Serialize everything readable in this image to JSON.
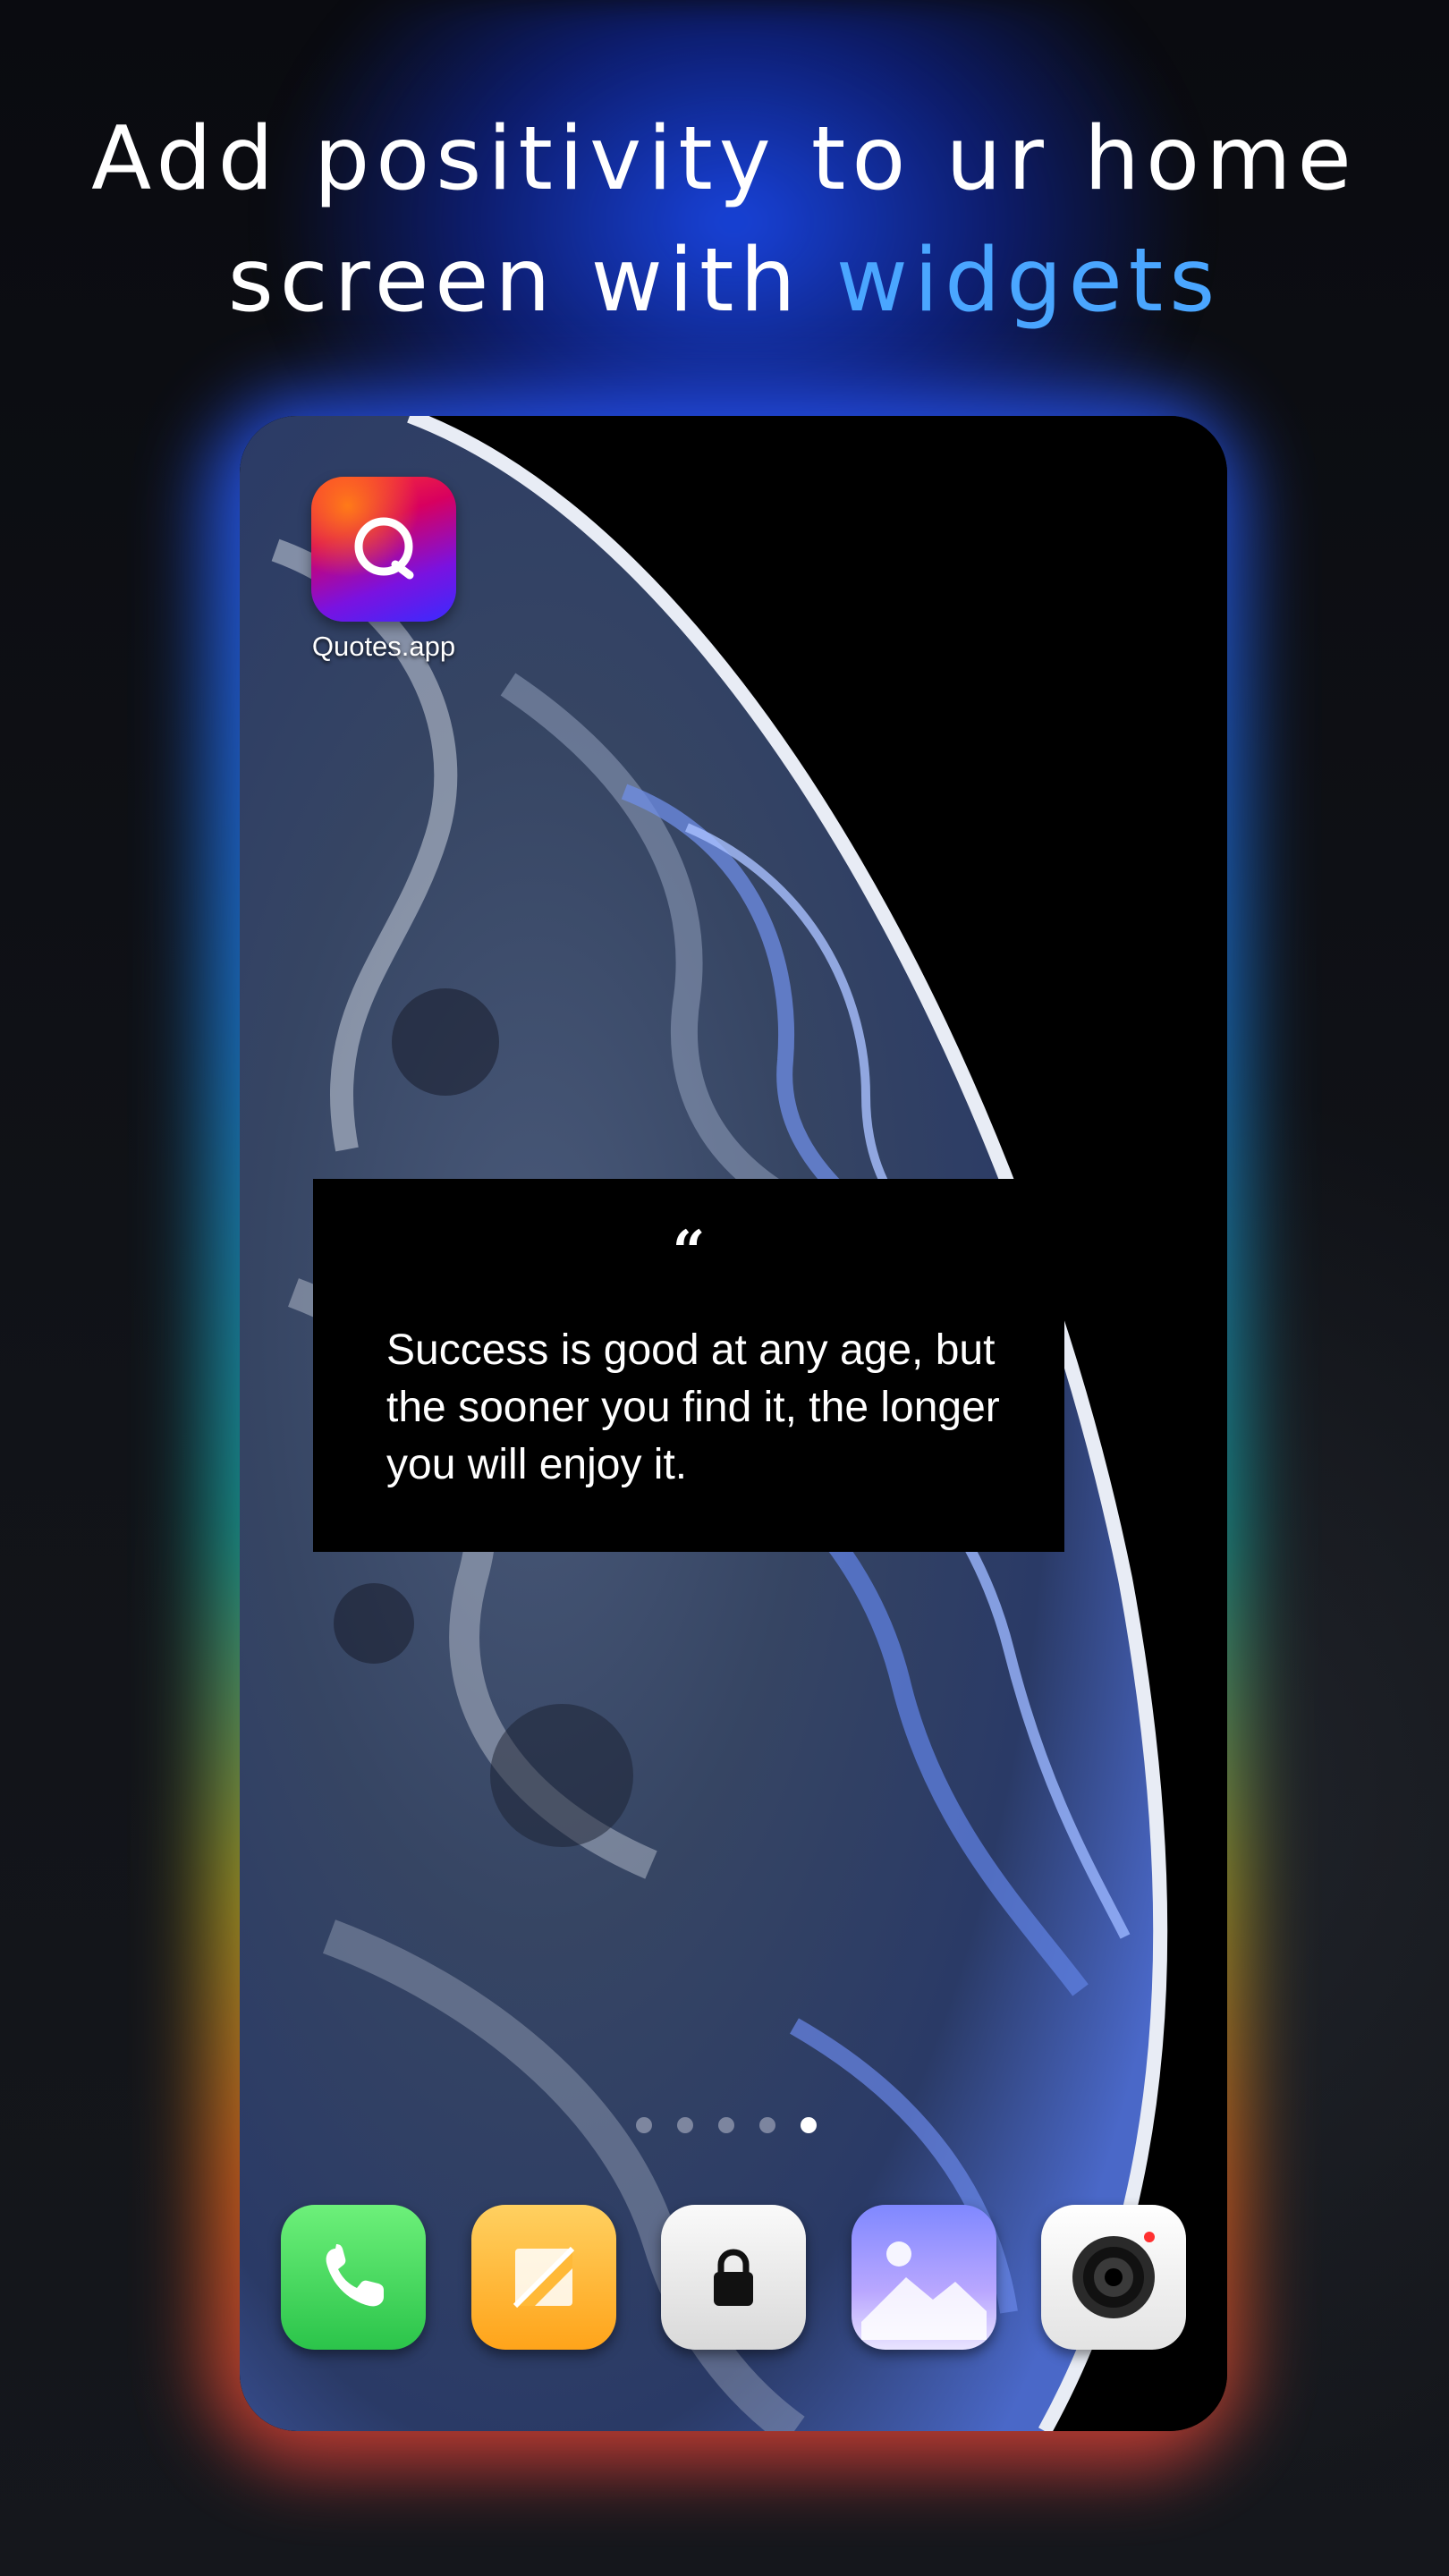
{
  "headline": {
    "line1": "Add positivity to ur home",
    "line2_prefix": "screen with ",
    "line2_accent": "widgets"
  },
  "app": {
    "label": "Quotes.app",
    "icon_letter": "Q"
  },
  "widget": {
    "quote_mark": "“",
    "quote_text": "Success is good at any age, but the sooner you find it, the longer you will enjoy it."
  },
  "pager": {
    "page_count": 5,
    "active_page": 5
  },
  "dock": {
    "apps": [
      "phone-icon",
      "notes-icon",
      "lock-icon",
      "gallery-icon",
      "camera-icon"
    ]
  },
  "colors": {
    "accent": "#4aa6ff",
    "background": "#0b0d12"
  }
}
